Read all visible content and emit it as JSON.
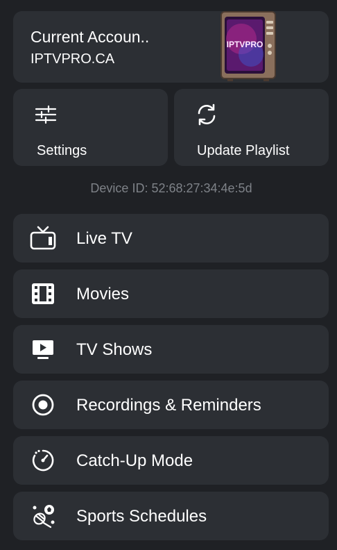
{
  "account": {
    "title": "Current Accoun..",
    "subtitle": "IPTVPRO.CA",
    "logo_text": "IPTVPRO"
  },
  "quick_actions": [
    {
      "label": "Settings",
      "icon": "sliders-icon"
    },
    {
      "label": "Update Playlist",
      "icon": "refresh-icon"
    }
  ],
  "device_id": "Device ID: 52:68:27:34:4e:5d",
  "menu": [
    {
      "label": "Live TV",
      "icon": "tv-icon"
    },
    {
      "label": "Movies",
      "icon": "film-icon"
    },
    {
      "label": "TV Shows",
      "icon": "play-screen-icon"
    },
    {
      "label": "Recordings & Reminders",
      "icon": "record-icon"
    },
    {
      "label": "Catch-Up Mode",
      "icon": "timer-icon"
    },
    {
      "label": "Sports Schedules",
      "icon": "sports-icon"
    }
  ],
  "colors": {
    "background": "#1f2125",
    "card": "#2c2f34",
    "text": "#ffffff",
    "muted": "#7e8288",
    "logo_accent": "#e6359a"
  }
}
